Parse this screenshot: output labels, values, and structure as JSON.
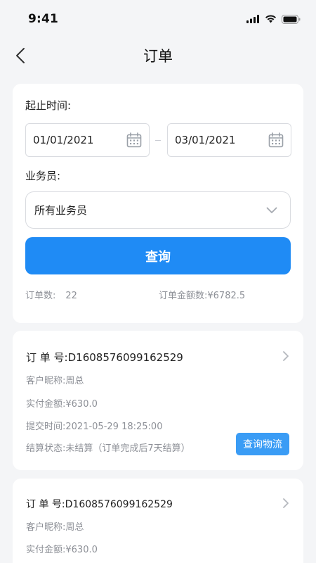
{
  "status_bar": {
    "time": "9:41"
  },
  "nav": {
    "title": "订单"
  },
  "filter": {
    "date_label": "起止时间:",
    "start_date": "01/01/2021",
    "end_date": "03/01/2021",
    "salesperson_label": "业务员:",
    "salesperson_value": "所有业务员",
    "query_label": "查询",
    "order_count_label": "订单数:",
    "order_count": "22",
    "order_amount_label": "订单金额数:",
    "order_amount": "¥6782.5"
  },
  "orders": [
    {
      "no_label": "订 单 号:",
      "no": "D1608576099162529",
      "customer_label": "客户昵称:",
      "customer": "周总",
      "paid_label": "实付金额:",
      "paid": "¥630.0",
      "time_label": "提交时间:",
      "time": "2021-05-29 18:25:00",
      "settle_label": "结算状态:",
      "settle": "未结算（订单完成后7天结算）",
      "logistics_label": "查询物流"
    },
    {
      "no_label": "订 单 号:",
      "no": "D1608576099162529",
      "customer_label": "客户昵称:",
      "customer": "周总",
      "paid_label": "实付金额:",
      "paid": "¥630.0"
    }
  ]
}
